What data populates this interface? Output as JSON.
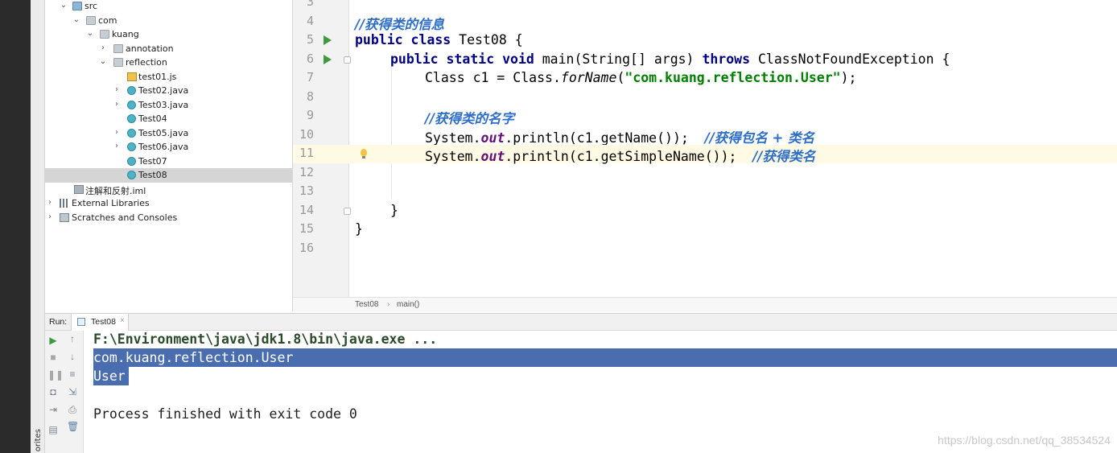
{
  "project_tree": {
    "items": [
      {
        "label": "src"
      },
      {
        "label": "com"
      },
      {
        "label": "kuang"
      },
      {
        "label": "annotation"
      },
      {
        "label": "reflection"
      },
      {
        "label": "test01.js"
      },
      {
        "label": "Test02.java"
      },
      {
        "label": "Test03.java"
      },
      {
        "label": "Test04"
      },
      {
        "label": "Test05.java"
      },
      {
        "label": "Test06.java"
      },
      {
        "label": "Test07"
      },
      {
        "label": "Test08"
      },
      {
        "label": "注解和反射.iml"
      },
      {
        "label": "External Libraries"
      },
      {
        "label": "Scratches and Consoles"
      }
    ]
  },
  "editor": {
    "lines": [
      {
        "num": "3"
      },
      {
        "num": "4",
        "comment": "//获得类的信息"
      },
      {
        "num": "5",
        "kw1": "public class",
        "text": " Test08 {"
      },
      {
        "num": "6",
        "kw1": "public static void",
        "text1": " main(String[] args) ",
        "kw2": "throws",
        "text2": " ClassNotFoundException {"
      },
      {
        "num": "7",
        "text1": "Class c1 = Class.",
        "italic": "forName",
        "text2": "(",
        "str": "\"com.kuang.reflection.User\"",
        "text3": ");"
      },
      {
        "num": "8"
      },
      {
        "num": "9",
        "comment": "//获得类的名字"
      },
      {
        "num": "10",
        "text1": "System.",
        "field": "out",
        "text2": ".println(c1.getName());  ",
        "comment": "//获得包名 + 类名"
      },
      {
        "num": "11",
        "text1": "System.",
        "field": "out",
        "text2": ".println(c1.getSimpleName());  ",
        "comment": "//获得类名"
      },
      {
        "num": "12"
      },
      {
        "num": "13"
      },
      {
        "num": "14",
        "text": "}"
      },
      {
        "num": "15",
        "text": "}"
      },
      {
        "num": "16"
      }
    ],
    "breadcrumb": {
      "class_name": "Test08",
      "separator": "›",
      "method": "main()"
    }
  },
  "run_panel": {
    "label": "Run:",
    "tab_label": "Test08",
    "tab_close": "×",
    "console_lines": {
      "command": "F:\\Environment\\java\\jdk1.8\\bin\\java.exe ...",
      "output1": "com.kuang.reflection.User",
      "output2": "User",
      "exit": "Process finished with exit code 0"
    }
  },
  "sidebar": {
    "favorites_label": "orites"
  },
  "watermark": "https://blog.csdn.net/qq_38534524",
  "colors": {
    "keyword": "#000080",
    "string": "#008000",
    "comment": "#2d6ec8",
    "field": "#660e7a",
    "selection": "#4a6db0",
    "run_green": "#3f9a3f"
  }
}
